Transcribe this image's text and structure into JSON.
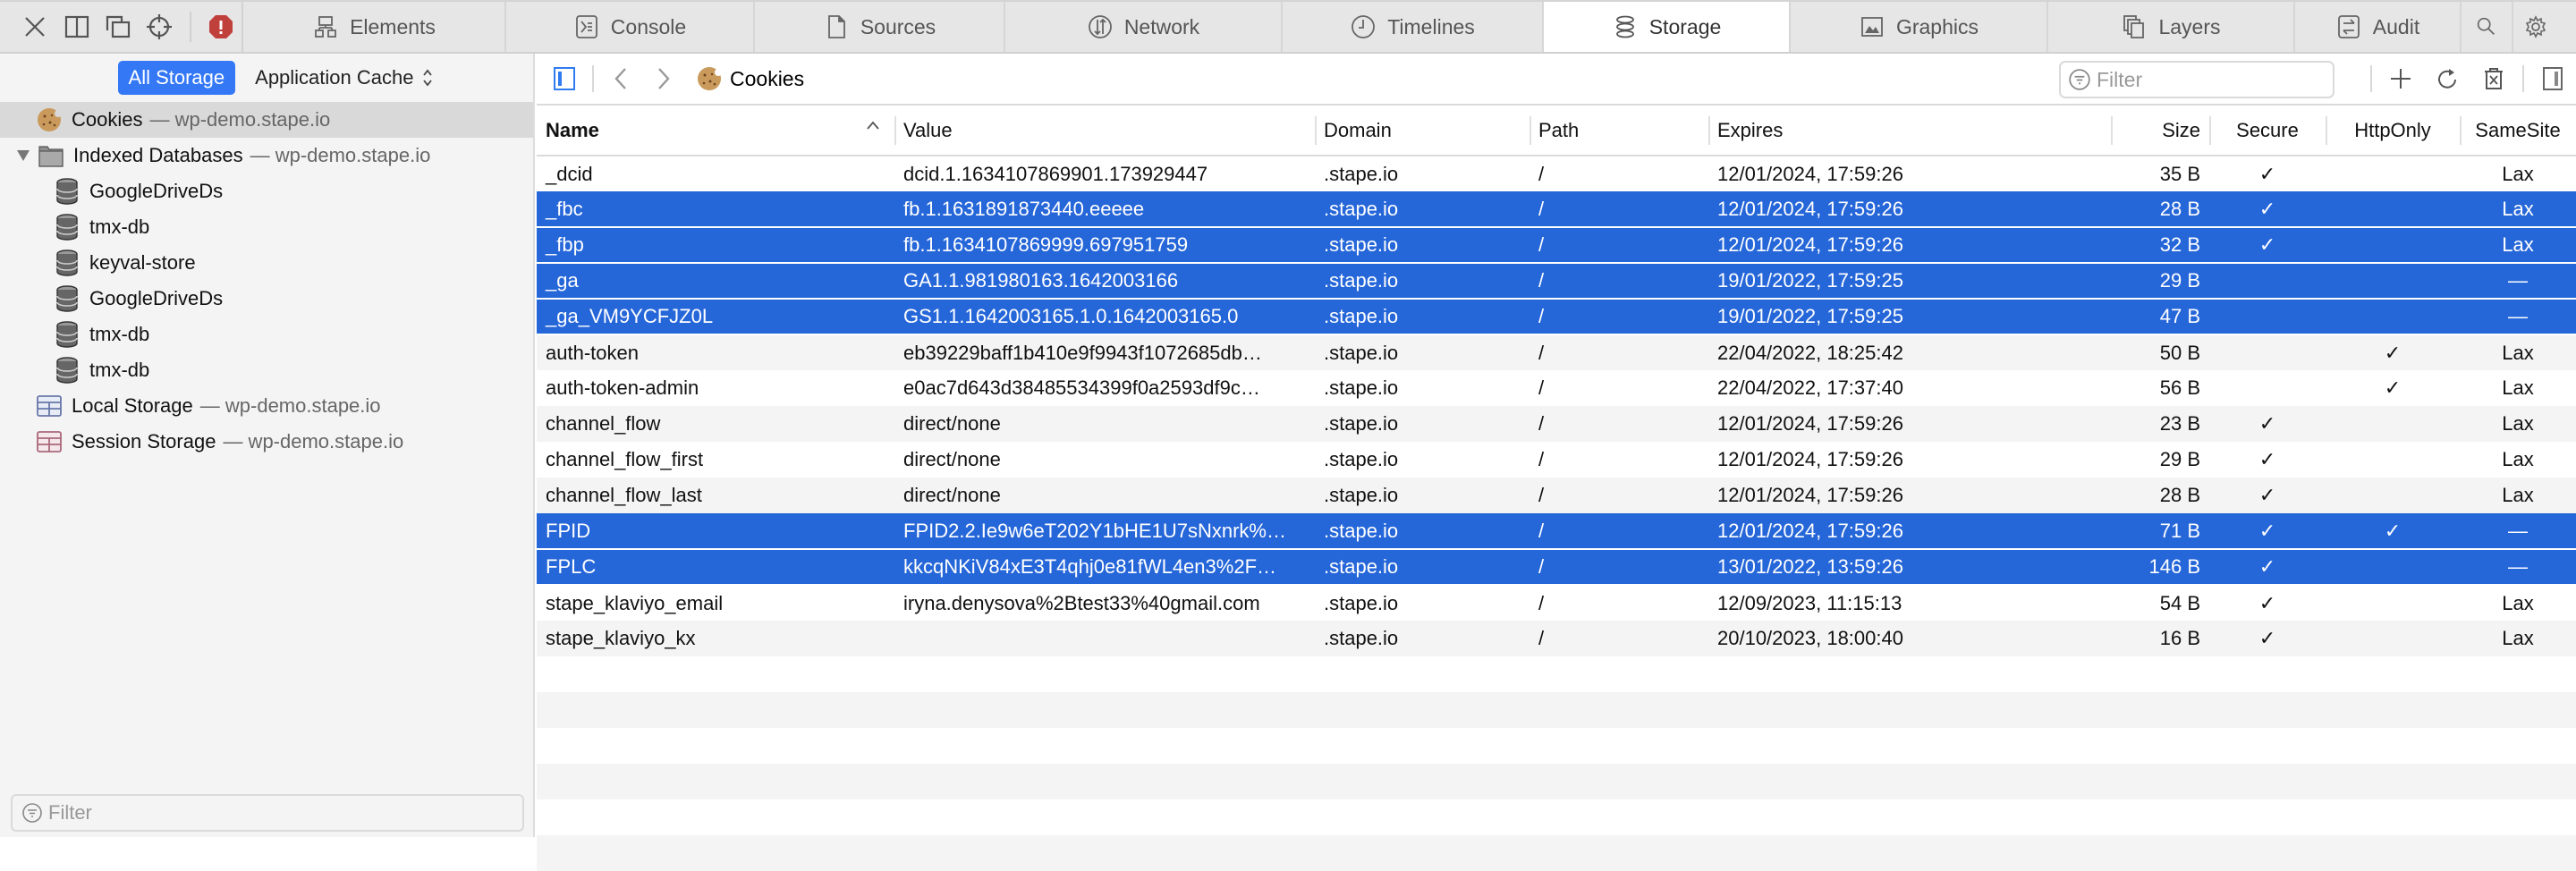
{
  "toolbar": {
    "icons": [
      "close-icon",
      "dock-side-icon",
      "undock-icon",
      "inspect-element-icon",
      "error-icon"
    ],
    "error_color": "#c0392b"
  },
  "tabs": [
    {
      "label": "Elements",
      "icon": "elements-icon"
    },
    {
      "label": "Console",
      "icon": "console-icon"
    },
    {
      "label": "Sources",
      "icon": "sources-icon"
    },
    {
      "label": "Network",
      "icon": "network-icon"
    },
    {
      "label": "Timelines",
      "icon": "timelines-icon"
    },
    {
      "label": "Storage",
      "icon": "storage-icon",
      "active": true
    },
    {
      "label": "Graphics",
      "icon": "graphics-icon"
    },
    {
      "label": "Layers",
      "icon": "layers-icon"
    },
    {
      "label": "Audit",
      "icon": "audit-icon"
    }
  ],
  "sidebar": {
    "scope_all": "All Storage",
    "scope_select": "Application Cache",
    "tree": {
      "cookies": {
        "label": "Cookies",
        "sub": "— wp-demo.stape.io"
      },
      "indexed": {
        "label": "Indexed Databases",
        "sub": "— wp-demo.stape.io"
      },
      "dbs": [
        "GoogleDriveDs",
        "tmx-db",
        "keyval-store",
        "GoogleDriveDs",
        "tmx-db",
        "tmx-db"
      ],
      "local": {
        "label": "Local Storage",
        "sub": "— wp-demo.stape.io"
      },
      "session": {
        "label": "Session Storage",
        "sub": "— wp-demo.stape.io"
      }
    },
    "filter_placeholder": "Filter"
  },
  "main": {
    "breadcrumb": "Cookies",
    "filter_placeholder": "Filter",
    "columns": [
      "Name",
      "Value",
      "Domain",
      "Path",
      "Expires",
      "Size",
      "Secure",
      "HttpOnly",
      "SameSite"
    ],
    "rows": [
      {
        "name": "_dcid",
        "value": "dcid.1.1634107869901.173929447",
        "domain": ".stape.io",
        "path": "/",
        "expires": "12/01/2024, 17:59:26",
        "size": "35 B",
        "secure": "✓",
        "httponly": "",
        "samesite": "Lax",
        "selected": false
      },
      {
        "name": "_fbc",
        "value": "fb.1.1631891873440.eeeee",
        "domain": ".stape.io",
        "path": "/",
        "expires": "12/01/2024, 17:59:26",
        "size": "28 B",
        "secure": "✓",
        "httponly": "",
        "samesite": "Lax",
        "selected": true
      },
      {
        "name": "_fbp",
        "value": "fb.1.1634107869999.697951759",
        "domain": ".stape.io",
        "path": "/",
        "expires": "12/01/2024, 17:59:26",
        "size": "32 B",
        "secure": "✓",
        "httponly": "",
        "samesite": "Lax",
        "selected": true
      },
      {
        "name": "_ga",
        "value": "GA1.1.981980163.1642003166",
        "domain": ".stape.io",
        "path": "/",
        "expires": "19/01/2022, 17:59:25",
        "size": "29 B",
        "secure": "",
        "httponly": "",
        "samesite": "—",
        "selected": true
      },
      {
        "name": "_ga_VM9YCFJZ0L",
        "value": "GS1.1.1642003165.1.0.1642003165.0",
        "domain": ".stape.io",
        "path": "/",
        "expires": "19/01/2022, 17:59:25",
        "size": "47 B",
        "secure": "",
        "httponly": "",
        "samesite": "—",
        "selected": true
      },
      {
        "name": "auth-token",
        "value": "eb39229baff1b410e9f9943f1072685db…",
        "domain": ".stape.io",
        "path": "/",
        "expires": "22/04/2022, 18:25:42",
        "size": "50 B",
        "secure": "",
        "httponly": "✓",
        "samesite": "Lax",
        "selected": false
      },
      {
        "name": "auth-token-admin",
        "value": "e0ac7d643d38485534399f0a2593df9c…",
        "domain": ".stape.io",
        "path": "/",
        "expires": "22/04/2022, 17:37:40",
        "size": "56 B",
        "secure": "",
        "httponly": "✓",
        "samesite": "Lax",
        "selected": false
      },
      {
        "name": "channel_flow",
        "value": "direct/none",
        "domain": ".stape.io",
        "path": "/",
        "expires": "12/01/2024, 17:59:26",
        "size": "23 B",
        "secure": "✓",
        "httponly": "",
        "samesite": "Lax",
        "selected": false
      },
      {
        "name": "channel_flow_first",
        "value": "direct/none",
        "domain": ".stape.io",
        "path": "/",
        "expires": "12/01/2024, 17:59:26",
        "size": "29 B",
        "secure": "✓",
        "httponly": "",
        "samesite": "Lax",
        "selected": false
      },
      {
        "name": "channel_flow_last",
        "value": "direct/none",
        "domain": ".stape.io",
        "path": "/",
        "expires": "12/01/2024, 17:59:26",
        "size": "28 B",
        "secure": "✓",
        "httponly": "",
        "samesite": "Lax",
        "selected": false
      },
      {
        "name": "FPID",
        "value": "FPID2.2.Ie9w6eT202Y1bHE1U7sNxnrk%…",
        "domain": ".stape.io",
        "path": "/",
        "expires": "12/01/2024, 17:59:26",
        "size": "71 B",
        "secure": "✓",
        "httponly": "✓",
        "samesite": "—",
        "selected": true
      },
      {
        "name": "FPLC",
        "value": "kkcqNKiV84xE3T4qhj0e81fWL4en3%2F…",
        "domain": ".stape.io",
        "path": "/",
        "expires": "13/01/2022, 13:59:26",
        "size": "146 B",
        "secure": "✓",
        "httponly": "",
        "samesite": "—",
        "selected": true
      },
      {
        "name": "stape_klaviyo_email",
        "value": "iryna.denysova%2Btest33%40gmail.com",
        "domain": ".stape.io",
        "path": "/",
        "expires": "12/09/2023, 11:15:13",
        "size": "54 B",
        "secure": "✓",
        "httponly": "",
        "samesite": "Lax",
        "selected": false
      },
      {
        "name": "stape_klaviyo_kx",
        "value": "",
        "domain": ".stape.io",
        "path": "/",
        "expires": "20/10/2023, 18:00:40",
        "size": "16 B",
        "secure": "✓",
        "httponly": "",
        "samesite": "Lax",
        "selected": false
      }
    ],
    "selection_color": "#2566d9"
  }
}
